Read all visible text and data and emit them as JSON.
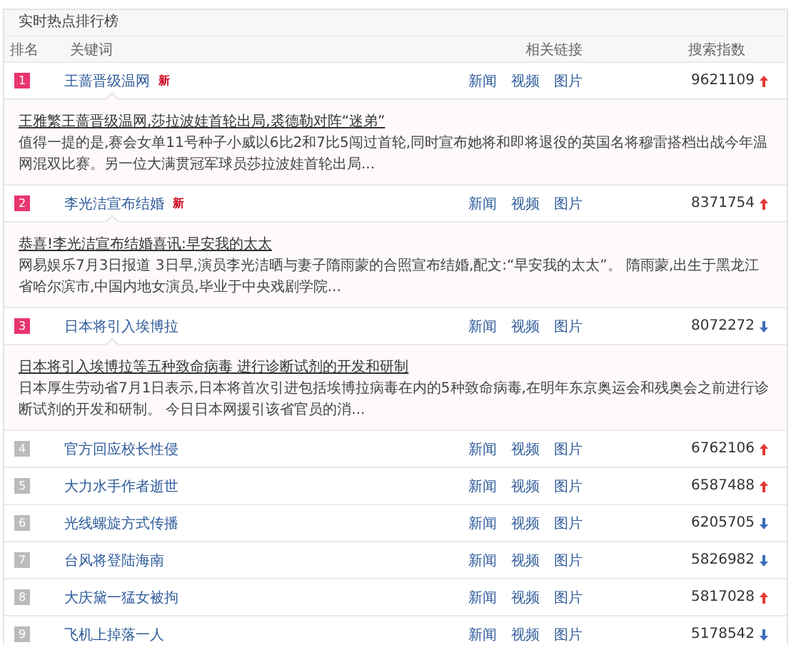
{
  "panel": {
    "title": "实时热点排行榜"
  },
  "columns": [
    "排名",
    "关键词",
    "相关链接",
    "搜索指数"
  ],
  "rows": [
    {
      "rank": "1",
      "keyword": "王蔷晋级温网",
      "badge": "新",
      "links": [
        "新闻",
        "视频",
        "图片"
      ],
      "index": "9621109",
      "rising": true,
      "detail": {
        "headline": "王雅繁王蔷晋级温网,莎拉波娃首轮出局,裘德勒对阵“迷弟”",
        "text": "值得一提的是,赛会女单11号种子小威以6比2和7比5闯过首轮,同时宣布她将和即将退役的英国名将穆雷搭档出战今年温网混双比赛。另一位大满贯冠军球员莎拉波娃首轮出局..."
      }
    },
    {
      "rank": "2",
      "keyword": "李光洁宣布结婚",
      "badge": "新",
      "links": [
        "新闻",
        "视频",
        "图片"
      ],
      "index": "8371754",
      "rising": true,
      "detail": {
        "headline": "恭喜!李光洁宣布结婚喜讯:早安我的太太",
        "text": "网易娱乐7月3日报道 3日早,演员李光洁晒与妻子隋雨蒙的合照宣布结婚,配文:“早安我的太太”。 隋雨蒙,出生于黑龙江省哈尔滨市,中国内地女演员,毕业于中央戏剧学院..."
      }
    },
    {
      "rank": "3",
      "keyword": "日本将引入埃博拉",
      "links": [
        "新闻",
        "视频",
        "图片"
      ],
      "index": "8072272",
      "rising": false,
      "detail": {
        "headline": "日本将引入埃博拉等五种致命病毒 进行诊断试剂的开发和研制",
        "text": "日本厚生劳动省7月1日表示,日本将首次引进包括埃博拉病毒在内的5种致命病毒,在明年东京奥运会和残奥会之前进行诊断试剂的开发和研制。 今日日本网援引该省官员的消..."
      }
    },
    {
      "rank": "4",
      "keyword": "官方回应校长性侵",
      "links": [
        "新闻",
        "视频",
        "图片"
      ],
      "index": "6762106",
      "rising": true
    },
    {
      "rank": "5",
      "keyword": "大力水手作者逝世",
      "links": [
        "新闻",
        "视频",
        "图片"
      ],
      "index": "6587488",
      "rising": true
    },
    {
      "rank": "6",
      "keyword": "光线螺旋方式传播",
      "links": [
        "新闻",
        "视频",
        "图片"
      ],
      "index": "6205705",
      "rising": false
    },
    {
      "rank": "7",
      "keyword": "台风将登陆海南",
      "links": [
        "新闻",
        "视频",
        "图片"
      ],
      "index": "5826982",
      "rising": false
    },
    {
      "rank": "8",
      "keyword": "大庆黛一猛女被拘",
      "links": [
        "新闻",
        "视频",
        "图片"
      ],
      "index": "5817028",
      "rising": true
    },
    {
      "rank": "9",
      "keyword": "飞机上掉落一人",
      "links": [
        "新闻",
        "视频",
        "图片"
      ],
      "index": "5178542",
      "rising": false
    }
  ]
}
